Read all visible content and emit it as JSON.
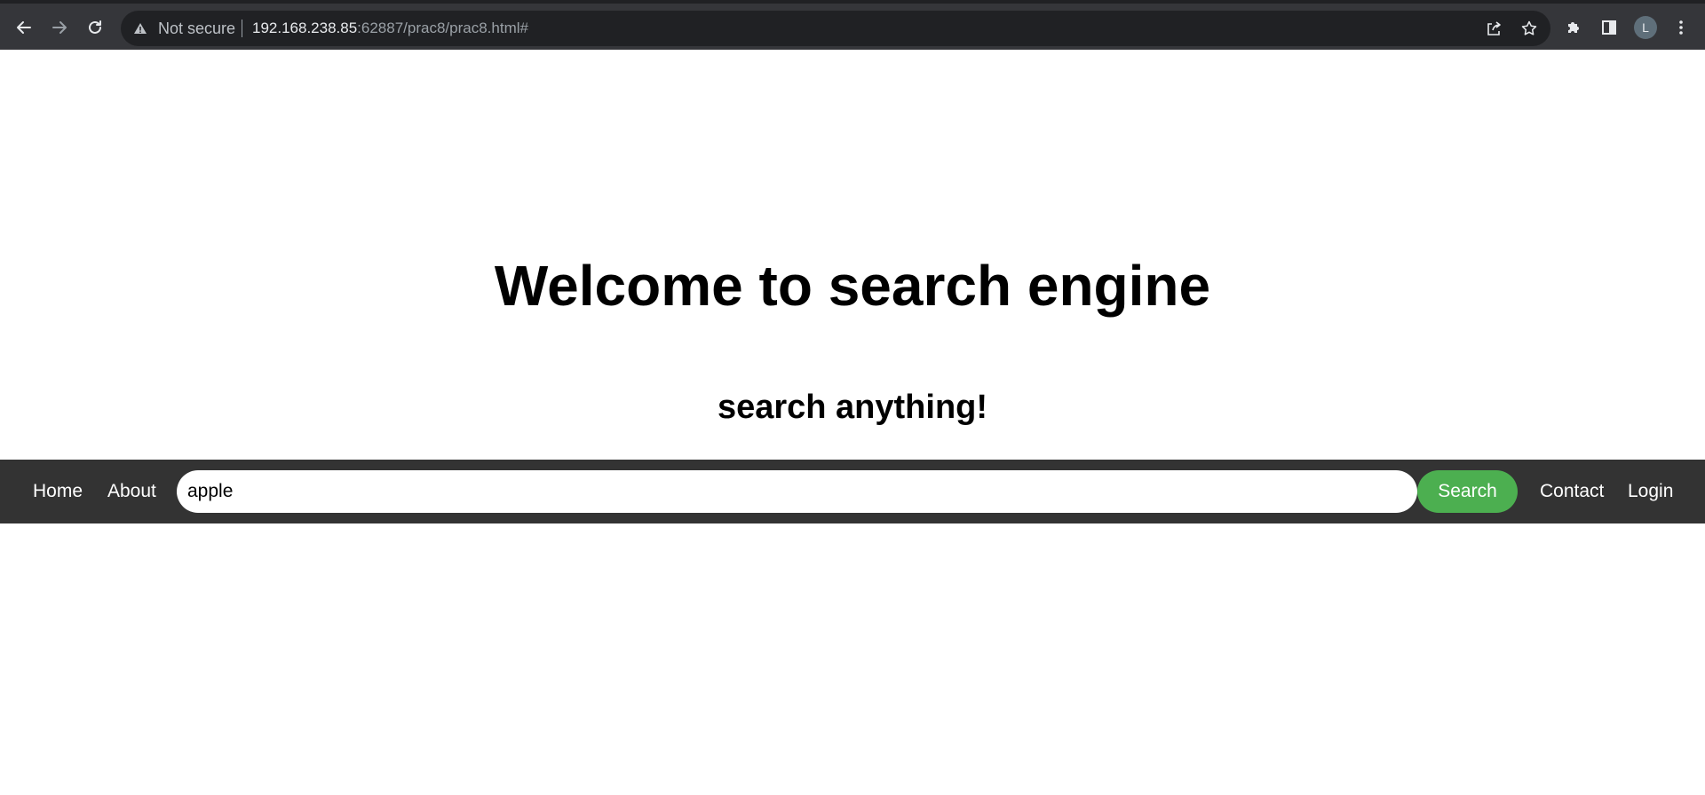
{
  "browser": {
    "security_label": "Not secure",
    "url_host": "192.168.238.85",
    "url_rest": ":62887/prac8/prac8.html#",
    "profile_initial": "L"
  },
  "page": {
    "title": "Welcome to search engine",
    "subtitle": "search anything!"
  },
  "navbar": {
    "home_label": "Home",
    "about_label": "About",
    "search_value": "apple",
    "search_button_label": "Search",
    "contact_label": "Contact",
    "login_label": "Login"
  },
  "colors": {
    "navbar_bg": "#333333",
    "search_button_bg": "#4caf50",
    "browser_bar_bg": "#35363a"
  },
  "icons": {
    "back": "arrow-left-icon",
    "forward": "arrow-right-icon",
    "reload": "reload-icon",
    "security": "warning-icon",
    "share": "share-icon",
    "bookmark": "star-icon",
    "extensions": "puzzle-icon",
    "side_panel": "side-panel-icon",
    "menu": "more-vert-icon"
  }
}
